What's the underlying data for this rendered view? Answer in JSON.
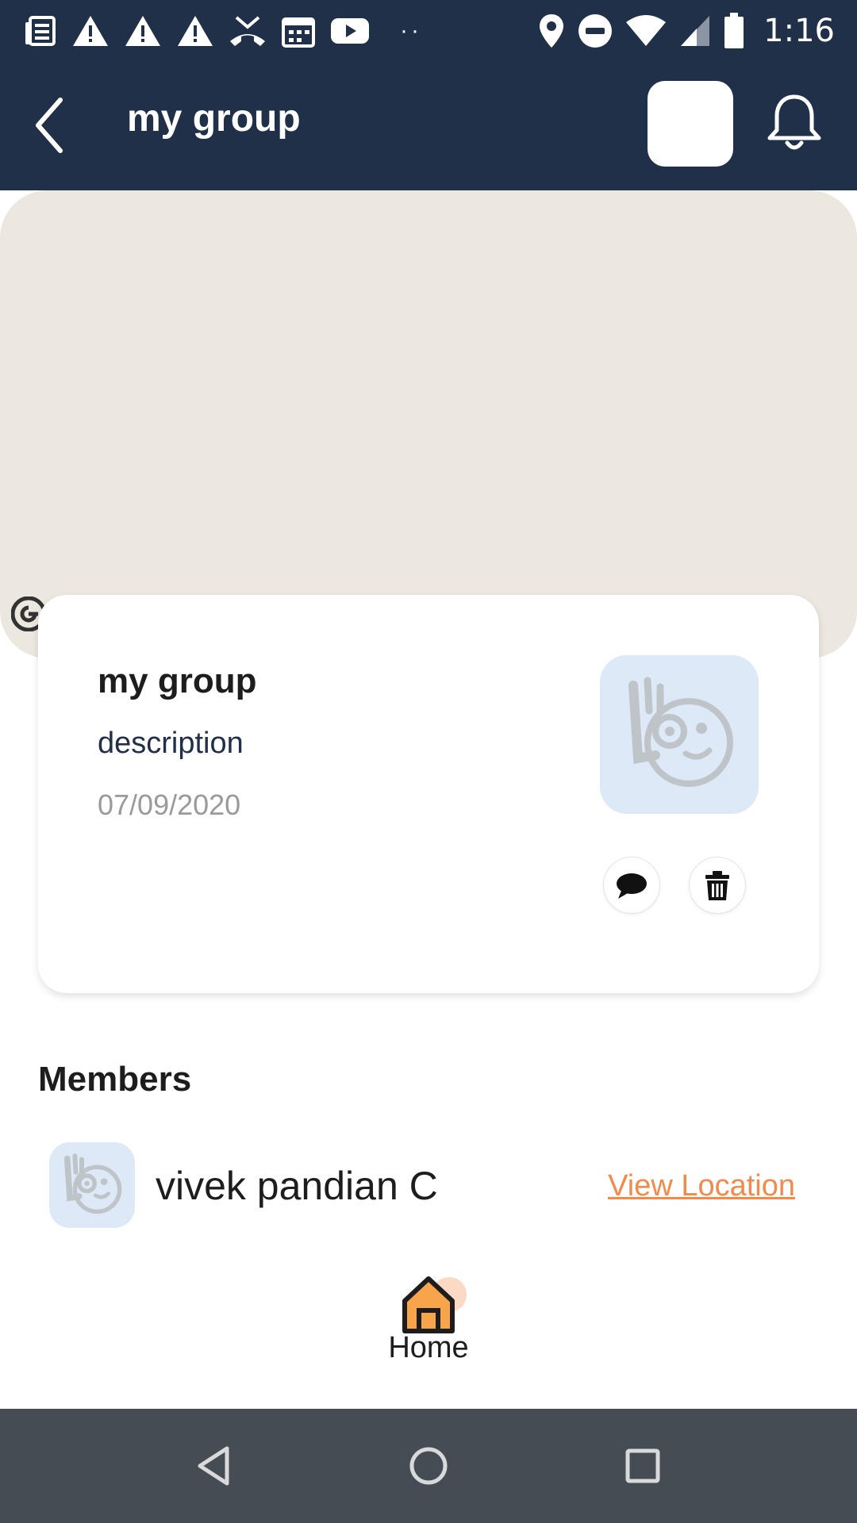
{
  "status_bar": {
    "time": "1:16",
    "left_icons": [
      "news-icon",
      "warning-icon",
      "warning-icon",
      "warning-icon",
      "missed-call-icon",
      "calendar-icon",
      "youtube-icon"
    ],
    "right_icons": [
      "location-icon",
      "do-not-disturb-icon",
      "wifi-icon",
      "signal-icon",
      "battery-icon"
    ]
  },
  "app_bar": {
    "title": "my group",
    "back_icon": "back-arrow-icon",
    "bell_icon": "bell-icon"
  },
  "group_card": {
    "title": "my group",
    "description": "description",
    "date": "07/09/2020",
    "actions": [
      "chat-icon",
      "trash-icon"
    ]
  },
  "members": {
    "heading": "Members",
    "items": [
      {
        "name": "vivek pandian C",
        "action_label": "View Location"
      }
    ]
  },
  "bottom_tab": {
    "label": "Home",
    "icon": "home-icon",
    "accent_color": "#f7a44a"
  },
  "colors": {
    "header_bg": "#203049",
    "banner_bg": "#ece8e0",
    "link_color": "#f38a4a",
    "avatar_bg": "#dde9f6",
    "nav_bar_bg": "#454c53"
  }
}
